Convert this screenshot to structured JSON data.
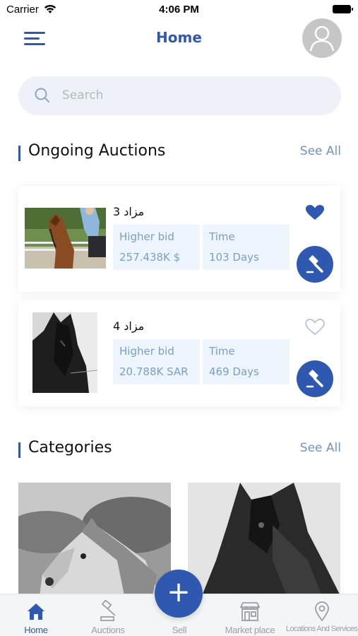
{
  "status_bar": {
    "carrier": "Carrier",
    "time": "4:06 PM"
  },
  "header": {
    "title": "Home",
    "menu_icon": "hamburger-menu-icon",
    "avatar_icon": "user-avatar-icon"
  },
  "search": {
    "placeholder": "Search",
    "value": "",
    "icon": "search-icon"
  },
  "ongoing_auctions": {
    "title": "Ongoing Auctions",
    "see_all": "See All",
    "items": [
      {
        "name": "مزاد 3",
        "bid_label": "Higher bid",
        "bid_value": "257.438K $",
        "time_label": "Time",
        "time_value": "103 Days",
        "favorited": true
      },
      {
        "name": "مزاد 4",
        "bid_label": "Higher bid",
        "bid_value": "20.788K SAR",
        "time_label": "Time",
        "time_value": "469 Days",
        "favorited": false
      }
    ]
  },
  "categories": {
    "title": "Categories",
    "see_all": "See All"
  },
  "tab_bar": {
    "tabs": [
      {
        "label": "Home",
        "icon": "home-icon",
        "active": true
      },
      {
        "label": "Auctions",
        "icon": "gavel-icon",
        "active": false
      },
      {
        "label": "Sell",
        "icon": "plus-icon",
        "active": false
      },
      {
        "label": "Market place",
        "icon": "store-icon",
        "active": false
      },
      {
        "label": "Locations And Services",
        "icon": "location-pin-icon",
        "active": false
      }
    ],
    "fab_label": "+"
  },
  "colors": {
    "accent": "#2f59b0",
    "muted_blue": "#6f93c2",
    "info_box_bg": "#eef4fb",
    "search_bg": "#eef2f8"
  }
}
